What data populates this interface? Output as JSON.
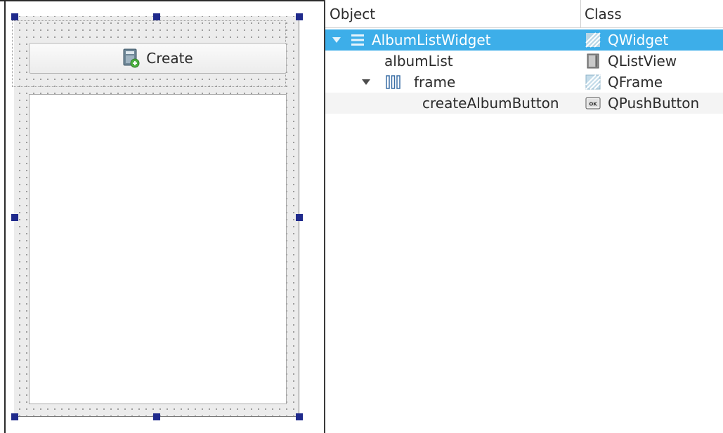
{
  "designer": {
    "create_button_label": "Create"
  },
  "inspector": {
    "header": {
      "object": "Object",
      "class": "Class"
    },
    "rows": [
      {
        "object": "AlbumListWidget",
        "class": "QWidget",
        "icon": "vertical-layout-icon",
        "class_icon": "widget-hatched-icon",
        "expanded": true,
        "selected": true
      },
      {
        "object": "albumList",
        "class": "QListView",
        "icon": "",
        "class_icon": "listview-icon"
      },
      {
        "object": "frame",
        "class": "QFrame",
        "icon": "horizontal-layout-icon",
        "class_icon": "frame-hatched-icon",
        "expanded": true
      },
      {
        "object": "createAlbumButton",
        "class": "QPushButton",
        "icon": "",
        "class_icon": "pushbutton-ok-icon"
      }
    ],
    "colors": {
      "selection": "#3daee9",
      "handle": "#1f2a8c"
    }
  }
}
